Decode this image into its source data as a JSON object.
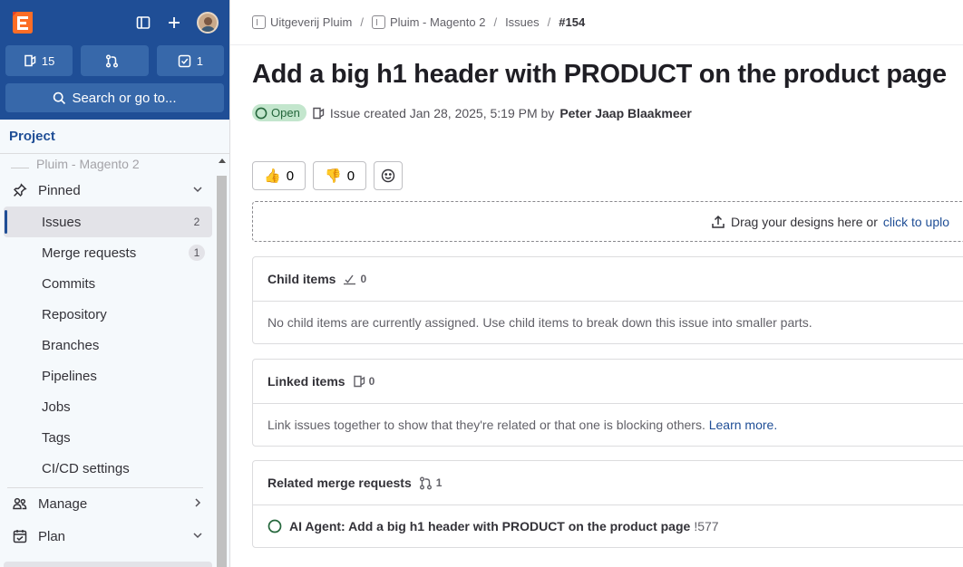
{
  "sidebar": {
    "counters": [
      {
        "icon": "issues-icon",
        "count": "15"
      },
      {
        "icon": "merge-request-icon",
        "count": ""
      },
      {
        "icon": "todo-icon",
        "count": "1"
      }
    ],
    "search_label": "Search or go to...",
    "project_heading": "Project",
    "faded_project_name": "Pluim - Magento 2",
    "pinned_label": "Pinned",
    "pinned_items": [
      {
        "label": "Issues",
        "badge": "2"
      },
      {
        "label": "Merge requests",
        "badge": "1"
      },
      {
        "label": "Commits"
      },
      {
        "label": "Repository"
      },
      {
        "label": "Branches"
      },
      {
        "label": "Pipelines"
      },
      {
        "label": "Jobs"
      },
      {
        "label": "Tags"
      },
      {
        "label": "CI/CD settings"
      }
    ],
    "manage_label": "Manage",
    "plan_label": "Plan"
  },
  "breadcrumb": {
    "group": "Uitgeverij Pluim",
    "project": "Pluim - Magento 2",
    "section": "Issues",
    "current": "#154"
  },
  "issue": {
    "title": "Add a big h1 header with PRODUCT on the product page",
    "status": "Open",
    "created_text": "Issue created Jan 28, 2025, 5:19 PM by",
    "author": "Peter Jaap Blaakmeer"
  },
  "reactions": {
    "thumbs_up": "👍",
    "thumbs_up_count": "0",
    "thumbs_down": "👎",
    "thumbs_down_count": "0"
  },
  "dropzone": {
    "text": "Drag your designs here or",
    "link": "click to uplo"
  },
  "child_items": {
    "title": "Child items",
    "count": "0",
    "empty_text": "No child items are currently assigned. Use child items to break down this issue into smaller parts."
  },
  "linked_items": {
    "title": "Linked items",
    "count": "0",
    "empty_text": "Link issues together to show that they're related or that one is blocking others.",
    "learn_more": "Learn more."
  },
  "related_mrs": {
    "title": "Related merge requests",
    "count": "1",
    "items": [
      {
        "title": "AI Agent: Add a big h1 header with PRODUCT on the product page",
        "ref": "!577"
      }
    ]
  },
  "colors": {
    "sidebar_top": "#1f4e96",
    "counter_bg": "#3768aa",
    "open_badge_bg": "#c3e6cd",
    "open_badge_text": "#24663b",
    "link": "#1f4e96"
  }
}
